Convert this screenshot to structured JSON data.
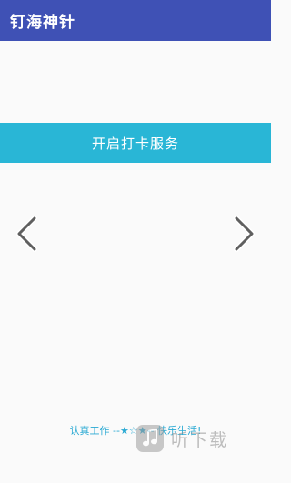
{
  "app_bar": {
    "title": "钉海神针",
    "color": "#3f51b5"
  },
  "main": {
    "action_button_label": "开启打卡服务",
    "action_button_color": "#29b6d6",
    "prev_icon": "chevron-left-icon",
    "next_icon": "chevron-right-icon",
    "footer_text": "认真工作 --★☆★-- 快乐生活!"
  },
  "watermark": {
    "text": "听下载",
    "logo_icon": "music-note-icon"
  }
}
